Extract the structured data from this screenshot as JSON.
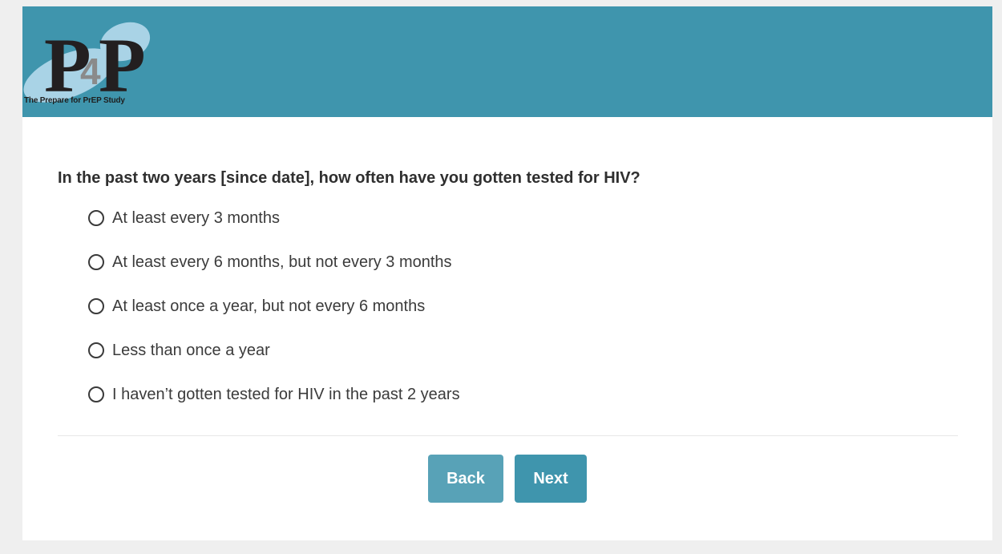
{
  "header": {
    "logo": {
      "mark_letters": [
        "P",
        "4",
        "P"
      ],
      "caption": "The Prepare for PrEP Study"
    },
    "background_color": "#3f95ad"
  },
  "survey": {
    "question": "In the past two years [since date], how often have you gotten tested for HIV?",
    "options": [
      "At least every 3 months",
      "At least every 6 months, but not every 3 months",
      "At least once a year, but not every 6 months",
      "Less than once a year",
      "I haven’t gotten tested for HIV in the past 2 years"
    ],
    "selected": null
  },
  "navigation": {
    "back_label": "Back",
    "next_label": "Next",
    "back_color": "#58a2b7",
    "next_color": "#3f95ad"
  }
}
